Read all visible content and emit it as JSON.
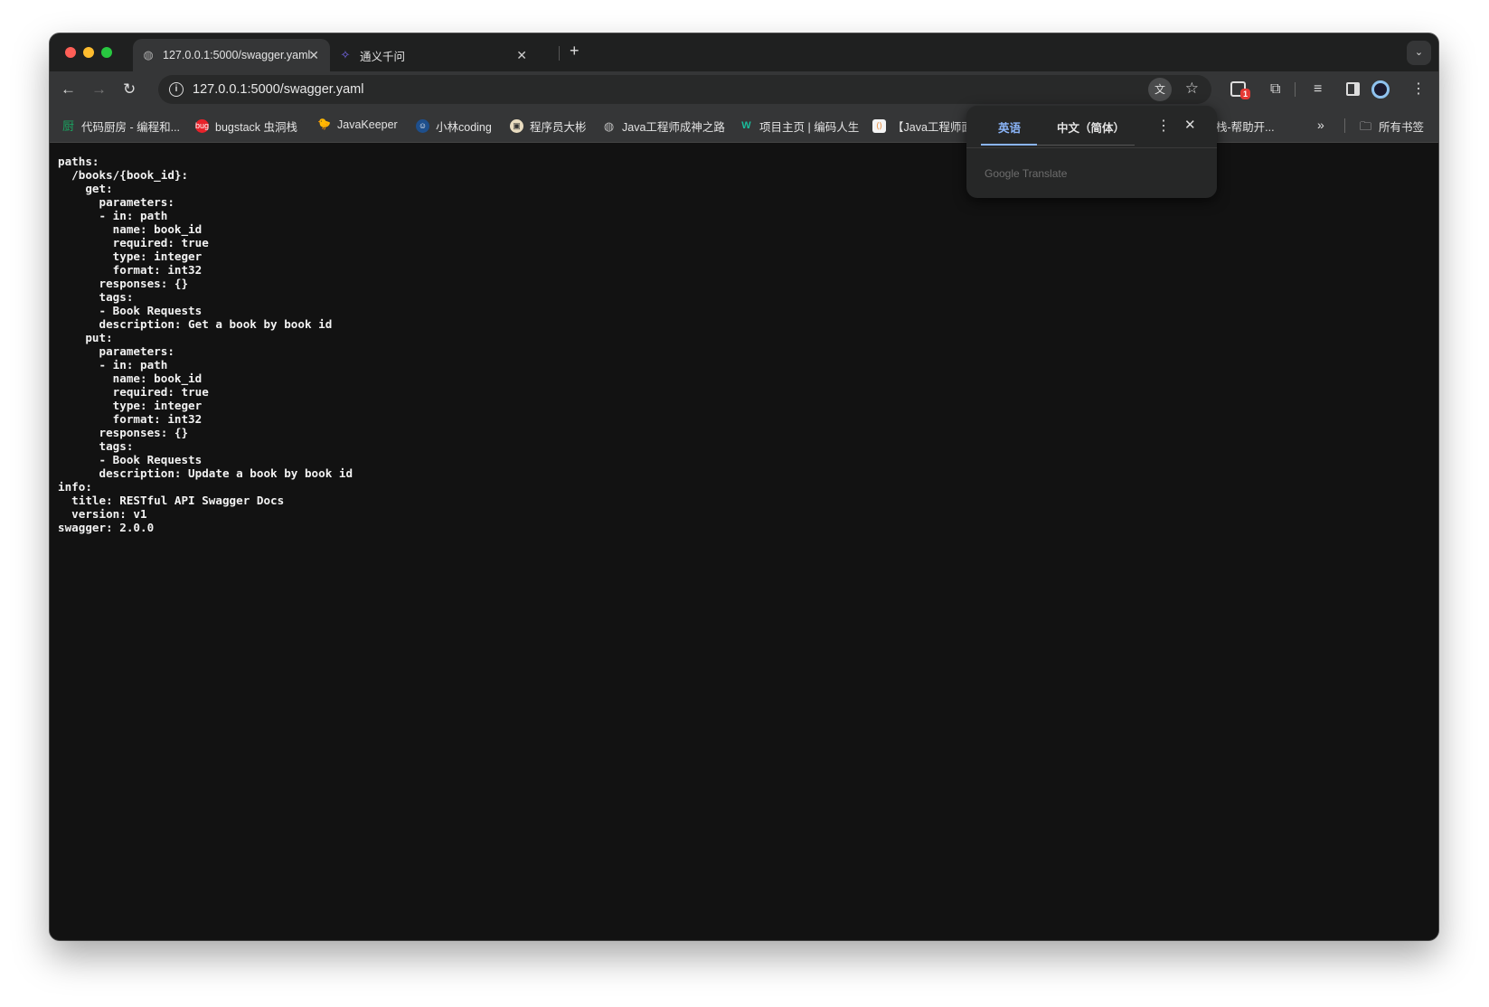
{
  "tabs": [
    {
      "title": "127.0.0.1:5000/swagger.yaml",
      "active": true
    },
    {
      "title": "通义千问",
      "active": false
    }
  ],
  "new_tab": "+",
  "address_bar": {
    "url": "127.0.0.1:5000/swagger.yaml"
  },
  "extension_badge": "1",
  "bookmarks": [
    "代码厨房 - 编程和...",
    "bugstack 虫洞栈",
    "JavaKeeper",
    "小林coding",
    "程序员大彬",
    "Java工程师成神之路",
    "项目主页 | 编码人生",
    "【Java工程师面",
    "栈-帮助开..."
  ],
  "all_bookmarks": "所有书签",
  "translate_popup": {
    "source_lang": "英语",
    "target_lang": "中文（简体）",
    "footer": "Google Translate"
  },
  "yaml_content": "paths:\n  /books/{book_id}:\n    get:\n      parameters:\n      - in: path\n        name: book_id\n        required: true\n        type: integer\n        format: int32\n      responses: {}\n      tags:\n      - Book Requests\n      description: Get a book by book id\n    put:\n      parameters:\n      - in: path\n        name: book_id\n        required: true\n        type: integer\n        format: int32\n      responses: {}\n      tags:\n      - Book Requests\n      description: Update a book by book id\ninfo:\n  title: RESTful API Swagger Docs\n  version: v1\nswagger: 2.0.0",
  "colors": {
    "accent": "#8ab4f8",
    "badge": "#e53935"
  }
}
